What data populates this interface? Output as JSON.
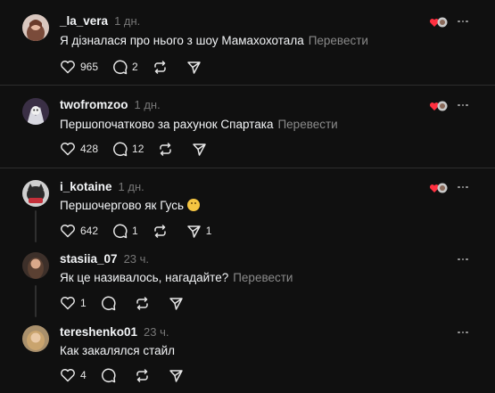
{
  "posts": [
    {
      "username": "_la_vera",
      "time": "1 дн.",
      "text": "Я дізналася про нього з шоу Мамахохотала",
      "translate": "Перевести",
      "likes": "965",
      "replies": "2",
      "reposts": "",
      "shares": "",
      "avatar_color": "#b48a7a"
    },
    {
      "username": "twofromzoo",
      "time": "1 дн.",
      "text": "Першопочатково за рахунок Спартака",
      "translate": "Перевести",
      "likes": "428",
      "replies": "12",
      "reposts": "",
      "shares": "",
      "avatar_color": "#4b3d56"
    },
    {
      "username": "i_kotaine",
      "time": "1 дн.",
      "text": "Першочергово як Гусь",
      "translate": "",
      "likes": "642",
      "replies": "1",
      "reposts": "",
      "shares": "1",
      "avatar_color": "#8a8a8a"
    },
    {
      "username": "stasiia_07",
      "time": "23 ч.",
      "text": "Як це називалось, нагадайте?",
      "translate": "Перевести",
      "likes": "1",
      "replies": "",
      "reposts": "",
      "shares": "",
      "avatar_color": "#6e5546"
    },
    {
      "username": "tereshenko01",
      "time": "23 ч.",
      "text": "Как закалялся стайл",
      "translate": "",
      "likes": "4",
      "replies": "",
      "reposts": "",
      "shares": "",
      "avatar_color": "#b89a6e"
    }
  ],
  "icons": {
    "like": "heart-icon",
    "reply": "comment-icon",
    "repost": "repost-icon",
    "share": "send-icon",
    "more": "more-icon",
    "liked_by_author": "liked-by-author-icon"
  },
  "colors": {
    "background": "#101010",
    "text": "#f3f5f7",
    "muted": "#777777",
    "liked_heart": "#ff3040"
  }
}
